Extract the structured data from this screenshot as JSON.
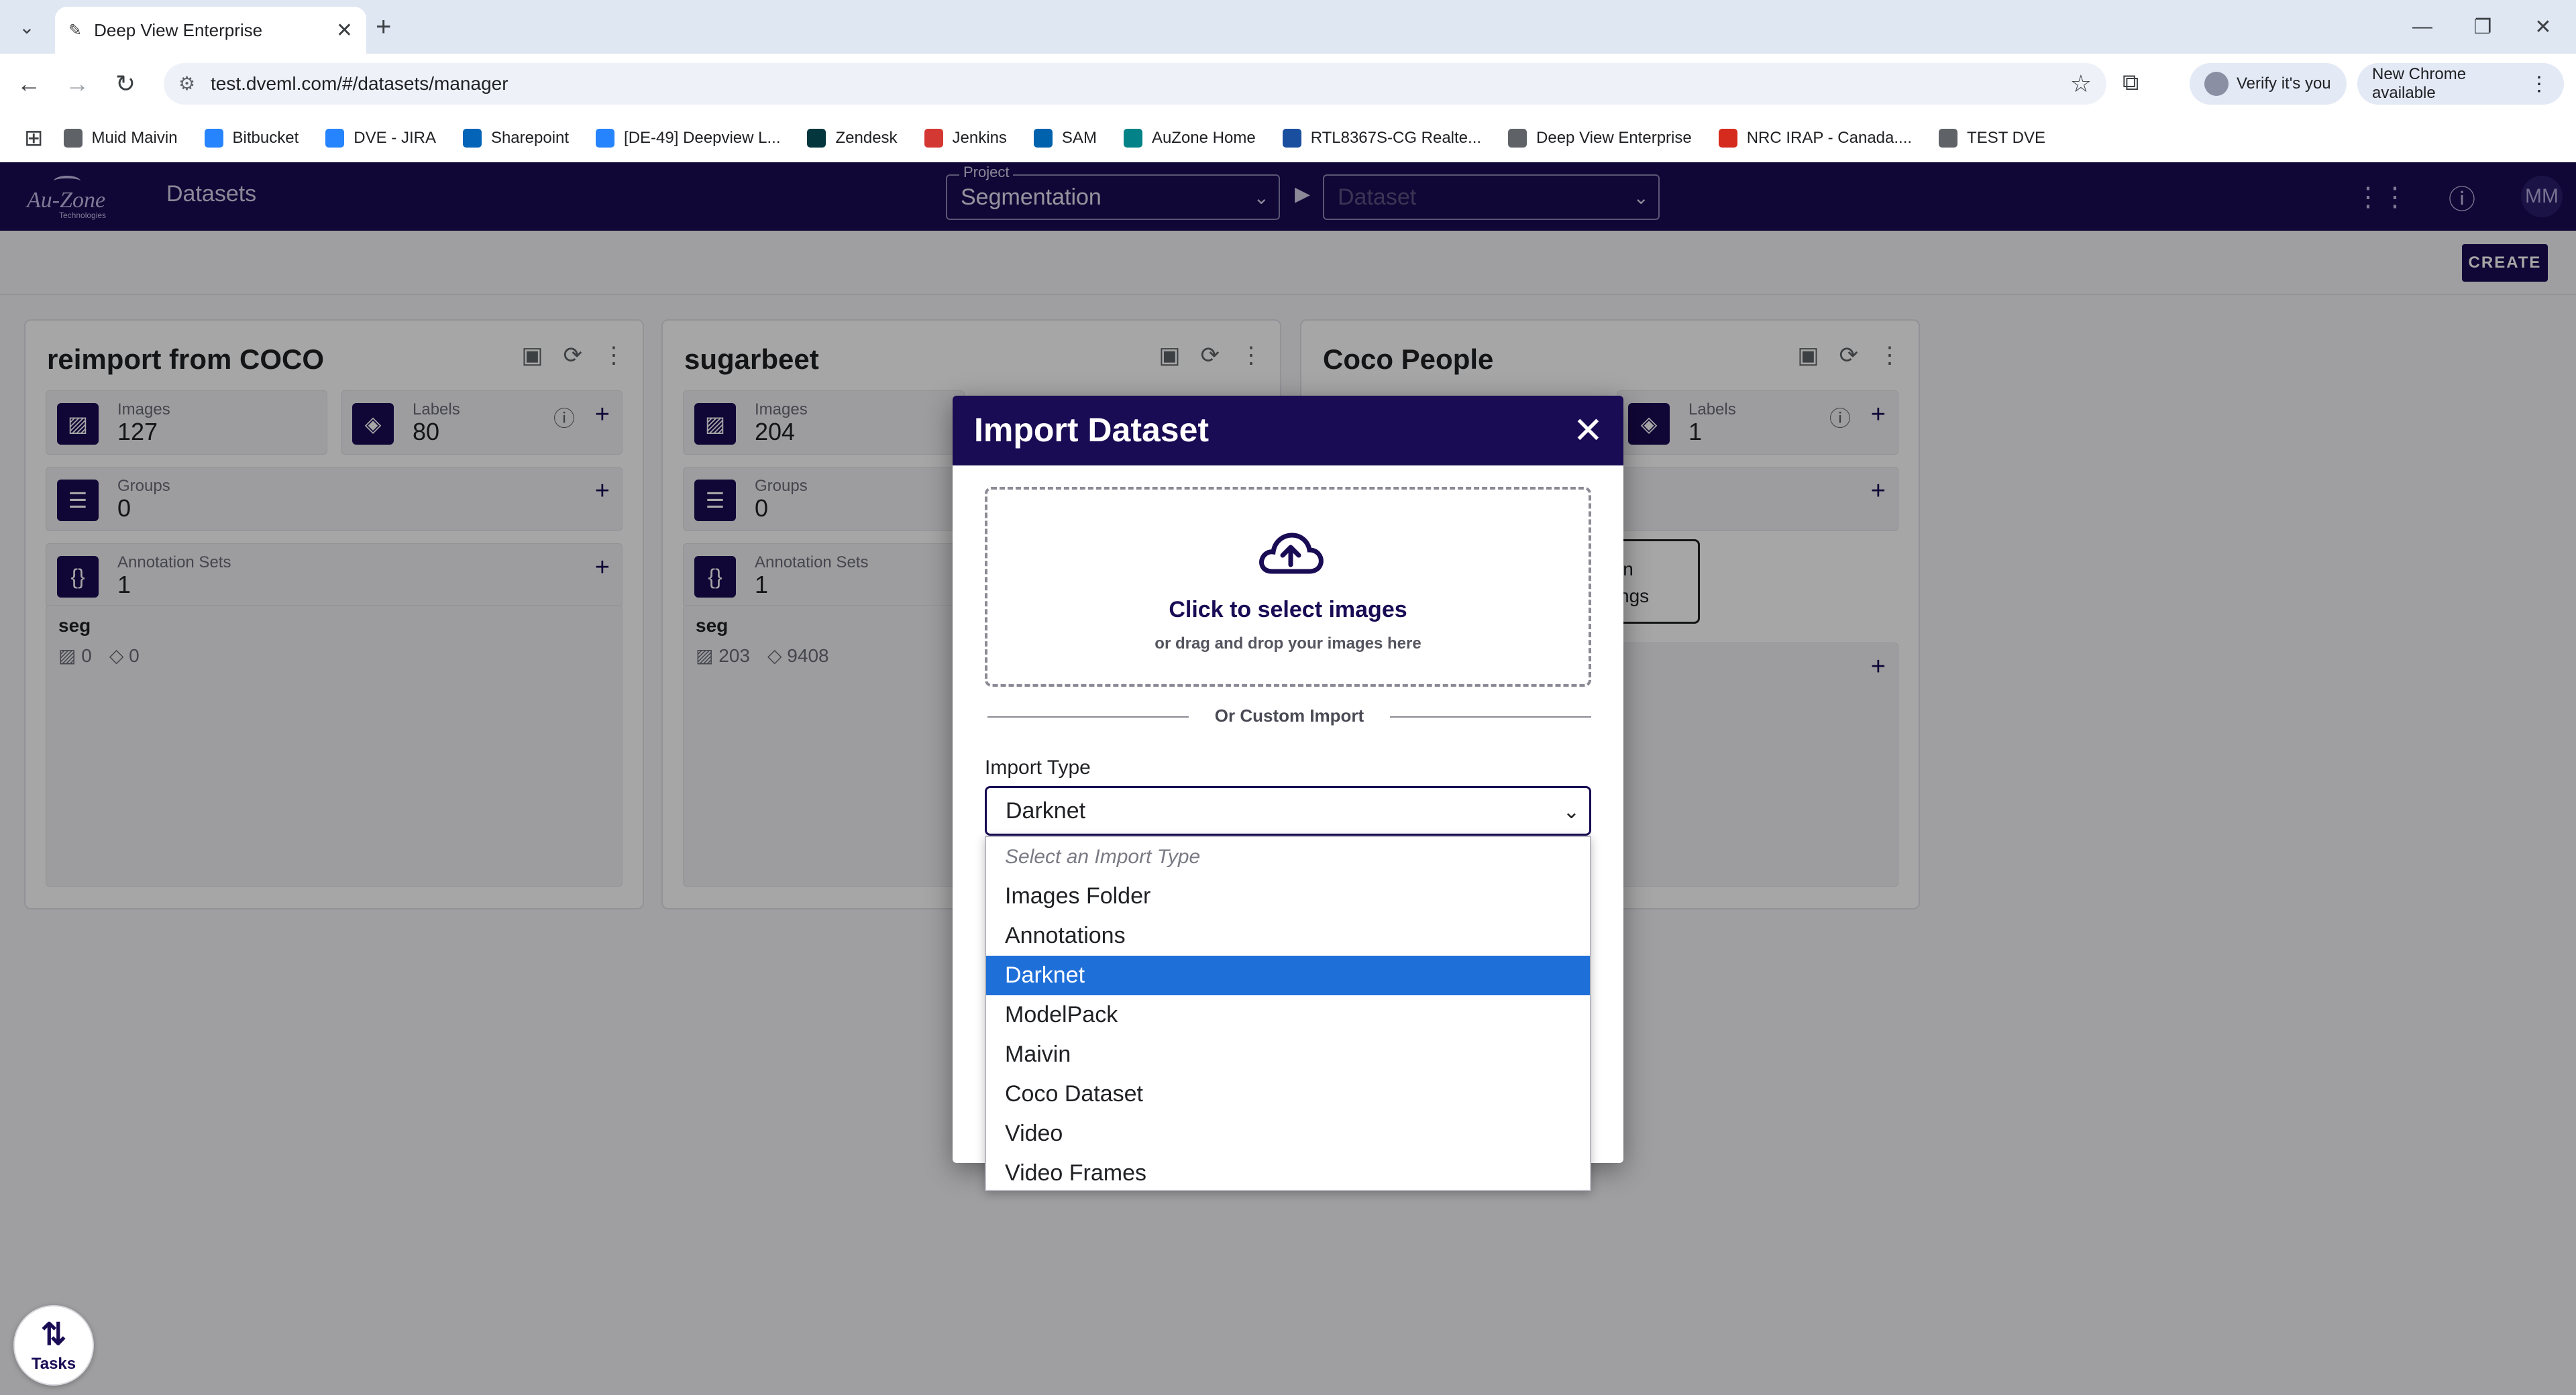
{
  "browser": {
    "tab_title": "Deep View Enterprise",
    "url": "test.dveml.com/#/datasets/manager",
    "verify_label": "Verify it's you",
    "update_label": "New Chrome available",
    "bookmarks": [
      {
        "label": "Muid Maivin",
        "color": "#5f6368"
      },
      {
        "label": "Bitbucket",
        "color": "#2684ff"
      },
      {
        "label": "DVE - JIRA",
        "color": "#2684ff"
      },
      {
        "label": "Sharepoint",
        "color": "#0364b8"
      },
      {
        "label": "[DE-49] Deepview L...",
        "color": "#2684ff"
      },
      {
        "label": "Zendesk",
        "color": "#03363d"
      },
      {
        "label": "Jenkins",
        "color": "#d33833"
      },
      {
        "label": "SAM",
        "color": "#0062ad"
      },
      {
        "label": "AuZone Home",
        "color": "#038387"
      },
      {
        "label": "RTL8367S-CG Realte...",
        "color": "#1a4fa0"
      },
      {
        "label": "Deep View Enterprise",
        "color": "#5f6368"
      },
      {
        "label": "NRC IRAP - Canada....",
        "color": "#d52b1e"
      },
      {
        "label": "TEST DVE",
        "color": "#5f6368"
      }
    ]
  },
  "header": {
    "logo_text": "Au-Zone",
    "logo_sub": "Technologies",
    "title": "Datasets",
    "project_legend": "Project",
    "project_value": "Segmentation",
    "dataset_placeholder": "Dataset",
    "avatar_initials": "MM"
  },
  "toolbar": {
    "create_label": "CREATE"
  },
  "cards": [
    {
      "title": "reimport from COCO",
      "images_label": "Images",
      "images_value": "127",
      "labels_label": "Labels",
      "labels_value": "80",
      "groups_label": "Groups",
      "groups_value": "0",
      "annos_label": "Annotation Sets",
      "annos_value": "1",
      "anno_name": "seg",
      "anno_images": "0",
      "anno_labels": "0"
    },
    {
      "title": "sugarbeet",
      "images_label": "Images",
      "images_value": "204",
      "groups_label": "Groups",
      "groups_value": "0",
      "annos_label": "Annotation Sets",
      "annos_value": "1",
      "anno_name": "seg",
      "anno_images": "203",
      "anno_labels": "9408"
    },
    {
      "title": "Coco People",
      "labels_label": "Labels",
      "labels_value": "1",
      "partial_button": "in\nngs"
    }
  ],
  "modal": {
    "title": "Import Dataset",
    "dropzone_main": "Click to select images",
    "dropzone_sub": "or drag and drop your images here",
    "divider_text": "Or Custom Import",
    "import_type_label": "Import Type",
    "import_type_value": "Darknet"
  },
  "dropdown": {
    "placeholder": "Select an Import Type",
    "options": [
      "Images Folder",
      "Annotations",
      "Darknet",
      "ModelPack",
      "Maivin",
      "Coco Dataset",
      "Video",
      "Video Frames"
    ],
    "selected": "Darknet"
  },
  "tasks": {
    "label": "Tasks"
  }
}
